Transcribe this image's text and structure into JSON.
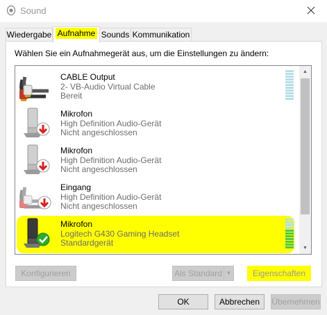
{
  "window": {
    "title": "Sound"
  },
  "tabs": [
    {
      "label": "Wiedergabe",
      "active": false
    },
    {
      "label": "Aufnahme",
      "active": true
    },
    {
      "label": "Sounds",
      "active": false
    },
    {
      "label": "Kommunikation",
      "active": false
    }
  ],
  "instruction": "Wählen Sie ein Aufnahmegerät aus, um die Einstellungen zu ändern:",
  "devices": [
    {
      "name": "CABLE Output",
      "description": "2- VB-Audio Virtual Cable",
      "status": "Bereit",
      "icon": "cable-connector-icon"
    },
    {
      "name": "Mikrofon",
      "description": "High Definition Audio-Gerät",
      "status": "Nicht angeschlossen",
      "icon": "microphone-disconnected-icon"
    },
    {
      "name": "Mikrofon",
      "description": "High Definition Audio-Gerät",
      "status": "Nicht angeschlossen",
      "icon": "microphone-disconnected-icon"
    },
    {
      "name": "Eingang",
      "description": "High Definition Audio-Gerät",
      "status": "Nicht angeschlossen",
      "icon": "line-in-disconnected-icon"
    },
    {
      "name": "Mikrofon",
      "description": "Logitech G430 Gaming Headset",
      "status": "Standardgerät",
      "icon": "microphone-default-icon",
      "selected": true
    }
  ],
  "buttons": {
    "configure": "Konfigurieren",
    "set_default": "Als Standard",
    "properties": "Eigenschaften",
    "ok": "OK",
    "cancel": "Abbrechen",
    "apply": "Übernehmen"
  },
  "colors": {
    "highlight": "#ffff00",
    "accent": "#0078d7",
    "status_green": "#2eaa2e",
    "status_red": "#d82020"
  }
}
